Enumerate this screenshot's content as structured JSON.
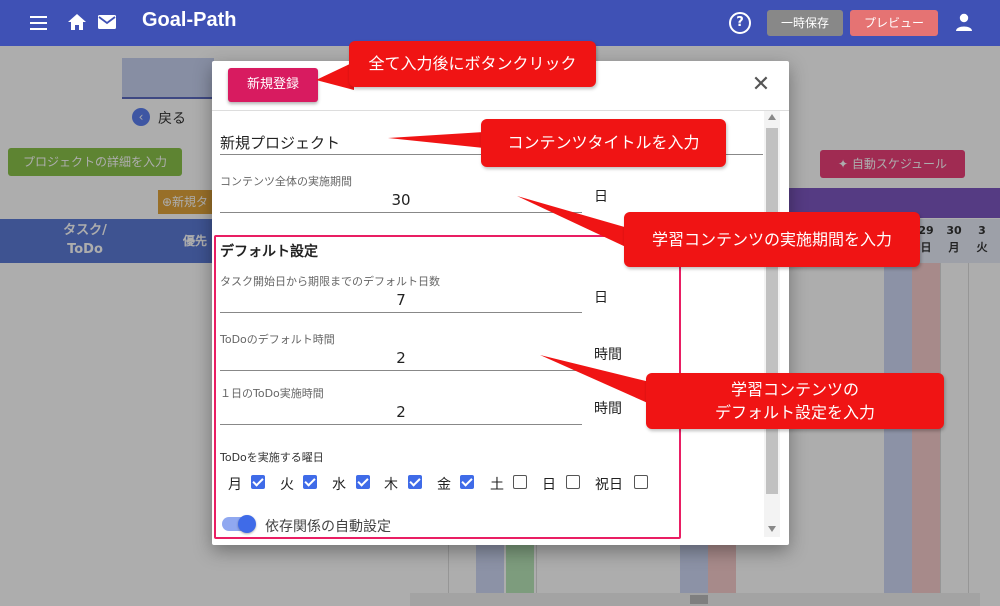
{
  "header": {
    "app_title": "Goal-Path",
    "save_label": "一時保存",
    "preview_label": "プレビュー",
    "help_symbol": "?"
  },
  "background": {
    "back_label": "戻る",
    "project_detail_button": "プロジェクトの詳細を入力",
    "auto_schedule_button": "自動スケジュール",
    "new_button_partial": "⊕新規タ",
    "task_header_line1": "タスク/",
    "task_header_line2": "ToDo",
    "priority_header_partial": "優先",
    "dates": [
      {
        "day": "29",
        "weekday": "日"
      },
      {
        "day": "30",
        "weekday": "月"
      },
      {
        "day": "3",
        "weekday": "火"
      }
    ]
  },
  "dialog": {
    "register_button": "新規登録",
    "close_symbol": "✕",
    "title_value": "新規プロジェクト",
    "period_label": "コンテンツ全体の実施期間",
    "period_value": "30",
    "period_unit": "日",
    "defaults_title": "デフォルト設定",
    "task_days_label": "タスク開始日から期限までのデフォルト日数",
    "task_days_value": "7",
    "task_days_unit": "日",
    "todo_hours_label": "ToDoのデフォルト時間",
    "todo_hours_value": "2",
    "todo_hours_unit": "時間",
    "daily_hours_label": "１日のToDo実施時間",
    "daily_hours_value": "2",
    "daily_hours_unit": "時間",
    "weekdays_label": "ToDoを実施する曜日",
    "weekdays": [
      {
        "label": "月",
        "checked": true
      },
      {
        "label": "火",
        "checked": true
      },
      {
        "label": "水",
        "checked": true
      },
      {
        "label": "木",
        "checked": true
      },
      {
        "label": "金",
        "checked": true
      },
      {
        "label": "土",
        "checked": false
      },
      {
        "label": "日",
        "checked": false
      },
      {
        "label": "祝日",
        "checked": false
      }
    ],
    "dependency_toggle_label": "依存関係の自動設定",
    "dependency_toggle_on": true
  },
  "annotations": {
    "register_hint": "全て入力後にボタンクリック",
    "title_hint": "コンテンツタイトルを入力",
    "period_hint": "学習コンテンツの実施期間を入力",
    "defaults_hint_line1": "学習コンテンツの",
    "defaults_hint_line2": "デフォルト設定を入力"
  },
  "colors": {
    "topbar": "#3f51b5",
    "register": "#d81b60",
    "checkbox": "#3f6be8",
    "callout": "#f01414",
    "highlight": "#e91e63"
  }
}
